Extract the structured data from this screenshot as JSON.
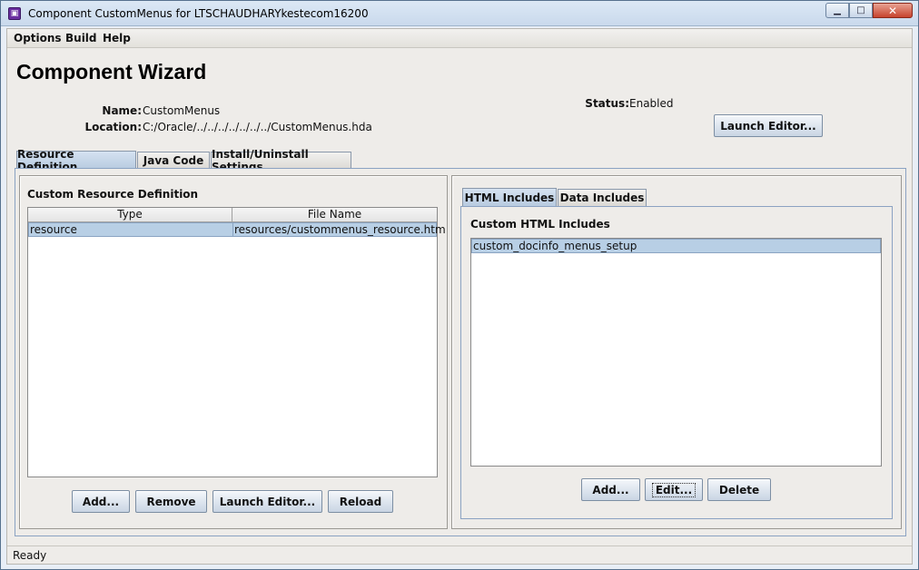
{
  "window": {
    "title": "Component CustomMenus for LTSCHAUDHARYkestecom16200",
    "minimize": "▁",
    "maximize": "□",
    "close": "✕"
  },
  "menu": {
    "items": [
      "Options",
      "Build",
      "Help"
    ]
  },
  "header": {
    "title": "Component Wizard",
    "name_label": "Name:",
    "name_value": "CustomMenus",
    "location_label": "Location:",
    "location_value": "C:/Oracle/../../../../../../../CustomMenus.hda",
    "status_label": "Status:",
    "status_value": "Enabled",
    "launch_editor": "Launch Editor..."
  },
  "tabs": [
    "Resource Definition",
    "Java Code",
    "Install/Uninstall Settings"
  ],
  "resource_panel": {
    "title": "Custom Resource Definition",
    "columns": [
      "Type",
      "File Name"
    ],
    "rows": [
      {
        "type": "resource",
        "file": "resources/custommenus_resource.htm"
      }
    ],
    "buttons": {
      "add": "Add...",
      "remove": "Remove",
      "launch": "Launch Editor...",
      "reload": "Reload"
    }
  },
  "includes_panel": {
    "tabs": [
      "HTML Includes",
      "Data Includes"
    ],
    "title": "Custom HTML Includes",
    "items": [
      "custom_docinfo_menus_setup"
    ],
    "buttons": {
      "add": "Add...",
      "edit": "Edit...",
      "delete": "Delete"
    }
  },
  "status_bar": {
    "text": "Ready"
  },
  "colors": {
    "selection": "#b8cfe5",
    "tab_active": "#c5d6ea",
    "close_button": "#c7432d"
  }
}
